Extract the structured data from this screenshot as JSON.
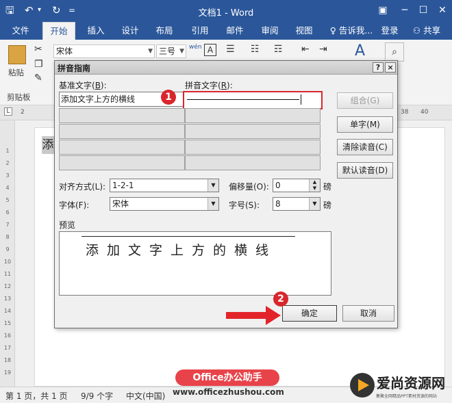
{
  "window": {
    "title": "文档1 - Word",
    "controls": {
      "help": "?",
      "minimize": "─",
      "maximize": "☐",
      "close": "✕"
    }
  },
  "quick_access": {
    "save": "🖫",
    "undo": "↶",
    "undo_dd": "▾",
    "redo": "↻",
    "customize": "="
  },
  "tabs": [
    {
      "label": "文件"
    },
    {
      "label": "开始",
      "active": true
    },
    {
      "label": "插入"
    },
    {
      "label": "设计"
    },
    {
      "label": "布局"
    },
    {
      "label": "引用"
    },
    {
      "label": "邮件"
    },
    {
      "label": "审阅"
    },
    {
      "label": "视图"
    }
  ],
  "tell_me": "♀ 告诉我...",
  "login": "登录",
  "share": "共享",
  "ribbon": {
    "paste_label": "粘贴",
    "clipboard_label": "剪贴板",
    "font_name": "宋体",
    "font_size": "三号",
    "pinyin_icon": "wén",
    "border_icon": "A"
  },
  "ruler": {
    "ticks": [
      "2",
      "38",
      "40"
    ]
  },
  "vruler_numbers": [
    "1",
    "2",
    "3",
    "4",
    "5",
    "6",
    "7",
    "8",
    "9",
    "10",
    "11",
    "12",
    "13",
    "14",
    "15",
    "16",
    "17",
    "18",
    "19"
  ],
  "document": {
    "selected_char": "添"
  },
  "status": {
    "page": "第 1 页，共 1 页",
    "words": "9/9 个字",
    "language": "中文(中国)"
  },
  "watermark": {
    "badge": "Office办公助手",
    "url": "www.officezhushou.com",
    "site": "爱尚资源网",
    "site_sub": "集聚全网精品PPT素材资源的网站"
  },
  "dialog": {
    "title": "拼音指南",
    "help": "?",
    "close": "×",
    "base_label": "基准文字(",
    "base_key": "B",
    "base_label_end": "):",
    "pinyin_label": "拼音文字(",
    "pinyin_key": "R",
    "pinyin_label_end": "):",
    "base_text": "添加文字上方的横线",
    "pinyin_text": "",
    "buttons": {
      "combine": "组合(G)",
      "single": "单字(M)",
      "clear": "清除读音(C)",
      "default": "默认读音(D)",
      "ok": "确定",
      "cancel": "取消"
    },
    "align_label": "对齐方式(L):",
    "align_value": "1-2-1",
    "offset_label": "偏移量(O):",
    "offset_value": "0",
    "offset_unit": "磅",
    "font_label": "字体(F):",
    "font_value": "宋体",
    "size_label": "字号(S):",
    "size_value": "8",
    "size_unit": "磅",
    "preview_label": "预览",
    "preview_text": "添加文字上方的横线"
  },
  "annotations": {
    "step1": "1",
    "step2": "2"
  },
  "colors": {
    "accent": "#2b579a",
    "highlight": "#d9262c"
  }
}
